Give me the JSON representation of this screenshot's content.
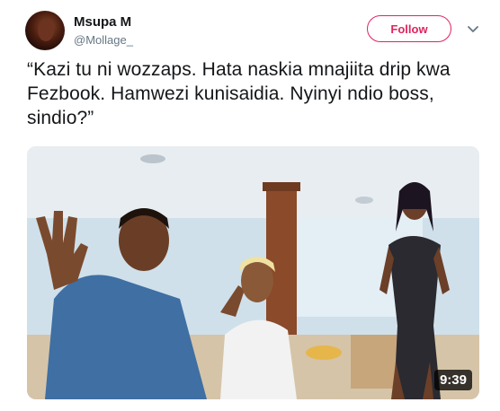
{
  "tweet": {
    "display_name": "Msupa M",
    "handle": "@Mollage_",
    "follow_label": "Follow",
    "text": "“Kazi tu ni wozzaps. Hata naskia mnajiita drip kwa Fezbook. Hamwezi kunisaidia. Nyinyi ndio boss, sindio?”",
    "media": {
      "duration": "9:39"
    }
  },
  "colors": {
    "follow_accent": "#e0245e",
    "text": "#14171a",
    "muted": "#657786"
  },
  "icons": {
    "menu_caret": "chevron-down-icon"
  }
}
